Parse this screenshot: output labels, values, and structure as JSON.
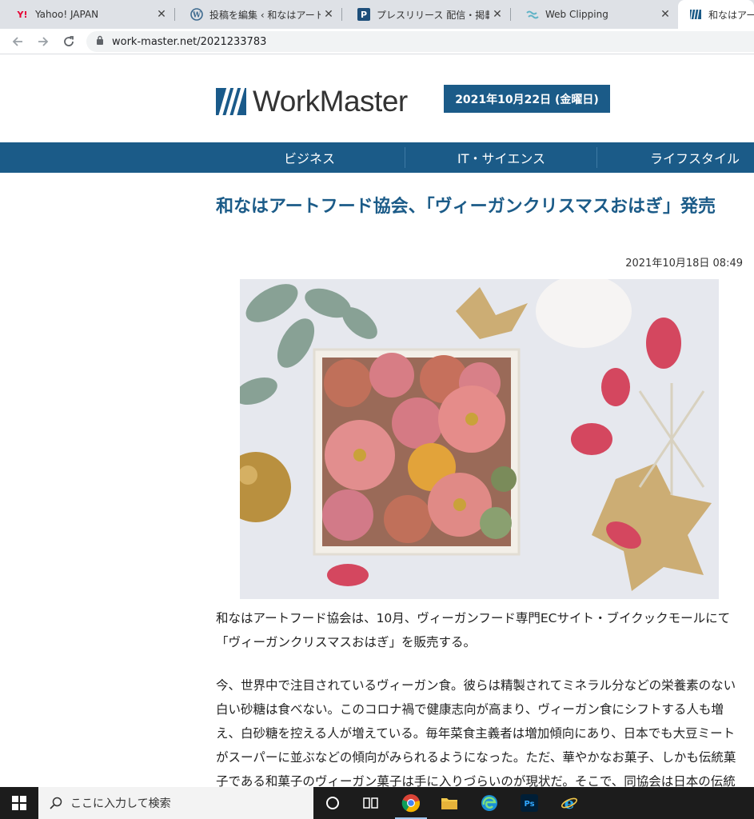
{
  "browser": {
    "tabs": [
      {
        "title": "Yahoo! JAPAN",
        "icon": "yahoo-icon"
      },
      {
        "title": "投稿を編集 ‹ 和なはアートフー",
        "icon": "wordpress-icon"
      },
      {
        "title": "プレスリリース 配信・掲載サービ",
        "icon": "pr-icon"
      },
      {
        "title": "Web Clipping",
        "icon": "webclip-icon"
      },
      {
        "title": "和なはアートフ",
        "icon": "workmaster-icon"
      }
    ],
    "url": "work-master.net/2021233783"
  },
  "site": {
    "logo_text": "WorkMaster",
    "date_badge": "2021年10月22日 (金曜日)",
    "nav": [
      "ビジネス",
      "IT・サイエンス",
      "ライフスタイル"
    ]
  },
  "article": {
    "title": "和なはアートフード協会、「ヴィーガンクリスマスおはぎ」発売",
    "published": "2021年10月18日 08:49",
    "paragraphs": [
      "和なはアートフード協会は、10月、ヴィーガンフード専門ECサイト・ブイクックモールにて「ヴィーガンクリスマスおはぎ」を販売する。",
      "今、世界中で注目されているヴィーガン食。彼らは精製されてミネラル分などの栄養素のない白い砂糖は食べない。このコロナ禍で健康志向が高まり、ヴィーガン食にシフトする人も増え、白砂糖を控える人が増えている。毎年菜食主義者は増加傾向にあり、日本でも大豆ミートがスーパーに並ぶなどの傾向がみられるようになった。ただ、華やかなお菓子、しかも伝統菓子である和菓子のヴィーガン菓子は手に入りづらいのが現状だ。そこで、同協会は日本の伝統的な和菓子を、ヴィーガン仕様にした"
    ]
  },
  "taskbar": {
    "search_placeholder": "ここに入力して検索"
  },
  "colors": {
    "brand": "#1b5b88",
    "tabstrip": "#dee1e6",
    "taskbar": "#1c1c1c"
  }
}
